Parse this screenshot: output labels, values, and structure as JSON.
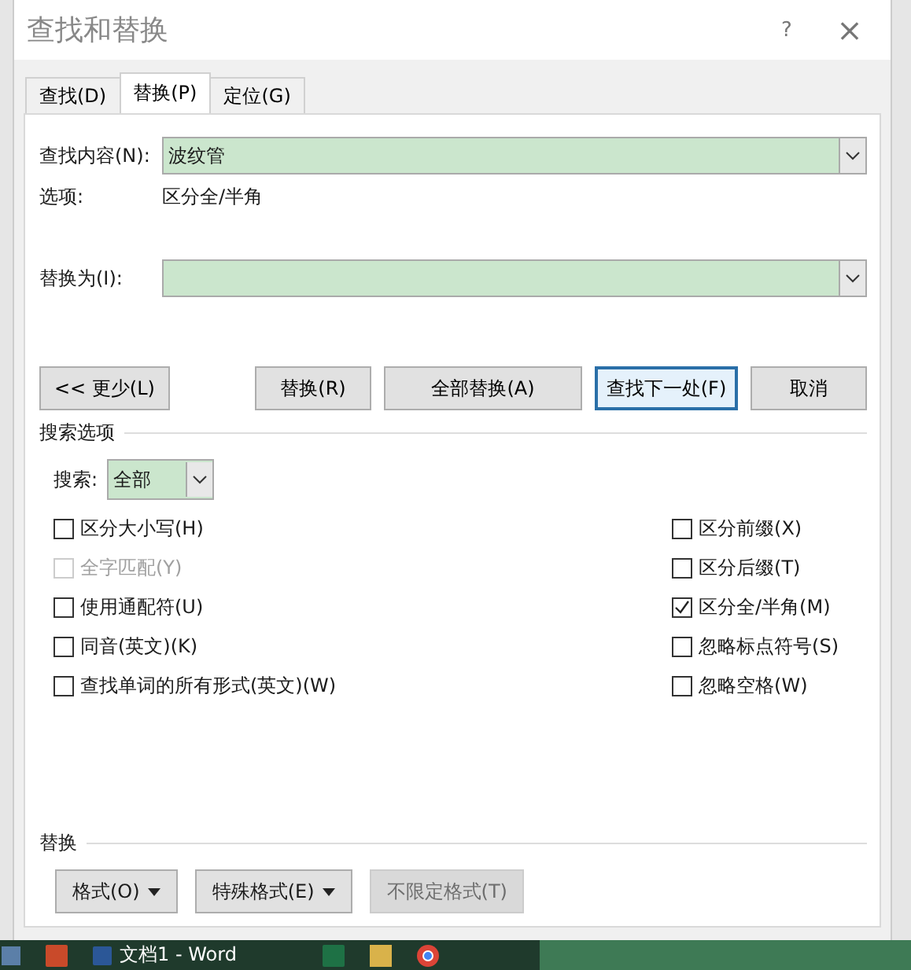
{
  "window": {
    "title": "查找和替换",
    "help": "?",
    "close": "×"
  },
  "tabs": [
    {
      "label": "查找(D)",
      "selected": false
    },
    {
      "label": "替换(P)",
      "selected": true
    },
    {
      "label": "定位(G)",
      "selected": false
    }
  ],
  "find_field": {
    "label": "查找内容(N):",
    "value": "波纹管"
  },
  "options_line": {
    "label": "选项:",
    "value": "区分全/半角"
  },
  "replace_field": {
    "label": "替换为(I):"
  },
  "buttons": [
    {
      "label": "<< 更少(L)",
      "default": false
    },
    {
      "label": "替换(R)",
      "default": false
    },
    {
      "label": "全部替换(A)",
      "default": false
    },
    {
      "label": "查找下一处(F)",
      "default": true
    },
    {
      "label": "取消",
      "default": false
    }
  ],
  "search_options": {
    "heading": "搜索选项",
    "search_label": "搜索:",
    "search_value": "全部",
    "left": [
      {
        "label": "区分大小写(H)",
        "checked": false,
        "disabled": false
      },
      {
        "label": "全字匹配(Y)",
        "checked": false,
        "disabled": true
      },
      {
        "label": "使用通配符(U)",
        "checked": false,
        "disabled": false
      },
      {
        "label": "同音(英文)(K)",
        "checked": false,
        "disabled": false
      },
      {
        "label": "查找单词的所有形式(英文)(W)",
        "checked": false,
        "disabled": false
      }
    ],
    "right": [
      {
        "label": "区分前缀(X)",
        "checked": false,
        "disabled": false
      },
      {
        "label": "区分后缀(T)",
        "checked": false,
        "disabled": false
      },
      {
        "label": "区分全/半角(M)",
        "checked": true,
        "disabled": false
      },
      {
        "label": "忽略标点符号(S)",
        "checked": false,
        "disabled": false
      },
      {
        "label": "忽略空格(W)",
        "checked": false,
        "disabled": false
      }
    ]
  },
  "replace_section": {
    "heading": "替换",
    "buttons": [
      {
        "label": "格式(O)",
        "dropdown": true,
        "disabled": false
      },
      {
        "label": "特殊格式(E)",
        "dropdown": true,
        "disabled": false
      },
      {
        "label": "不限定格式(T)",
        "dropdown": false,
        "disabled": true
      }
    ]
  },
  "taskbar": {
    "word_item": "文档1 - Word"
  }
}
